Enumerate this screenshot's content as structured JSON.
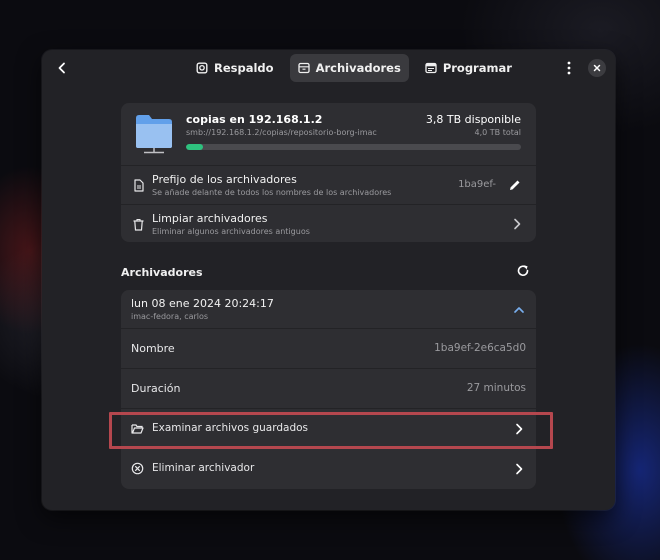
{
  "header": {
    "tabs": [
      {
        "label": "Respaldo",
        "icon": "backup-icon",
        "active": false
      },
      {
        "label": "Archivadores",
        "icon": "archive-icon",
        "active": true
      },
      {
        "label": "Programar",
        "icon": "calendar-icon",
        "active": false
      }
    ]
  },
  "repository": {
    "title": "copias en 192.168.1.2",
    "url": "smb://192.168.1.2/copias/repositorio-borg-imac",
    "available": "3,8 TB disponible",
    "total": "4,0 TB total",
    "usage_fraction": 0.05,
    "accent_color": "#2ec27e",
    "folder_color": "#62a0ea"
  },
  "settings": {
    "prefix": {
      "title": "Prefijo de los archivadores",
      "subtitle": "Se añade delante de todos los nombres de los archivadores",
      "value": "1ba9ef-"
    },
    "cleanup": {
      "title": "Limpiar archivadores",
      "subtitle": "Eliminar algunos archivadores antiguos"
    }
  },
  "archives": {
    "section_title": "Archivadores",
    "item": {
      "date": "lun 08 ene 2024 20:24:17",
      "meta": "imac-fedora, carlos",
      "name_label": "Nombre",
      "name_value": "1ba9ef-2e6ca5d0",
      "duration_label": "Duración",
      "duration_value": "27 minutos",
      "browse_label": "Examinar archivos guardados",
      "delete_label": "Eliminar archivador"
    }
  },
  "highlight_color": "#b5474e"
}
